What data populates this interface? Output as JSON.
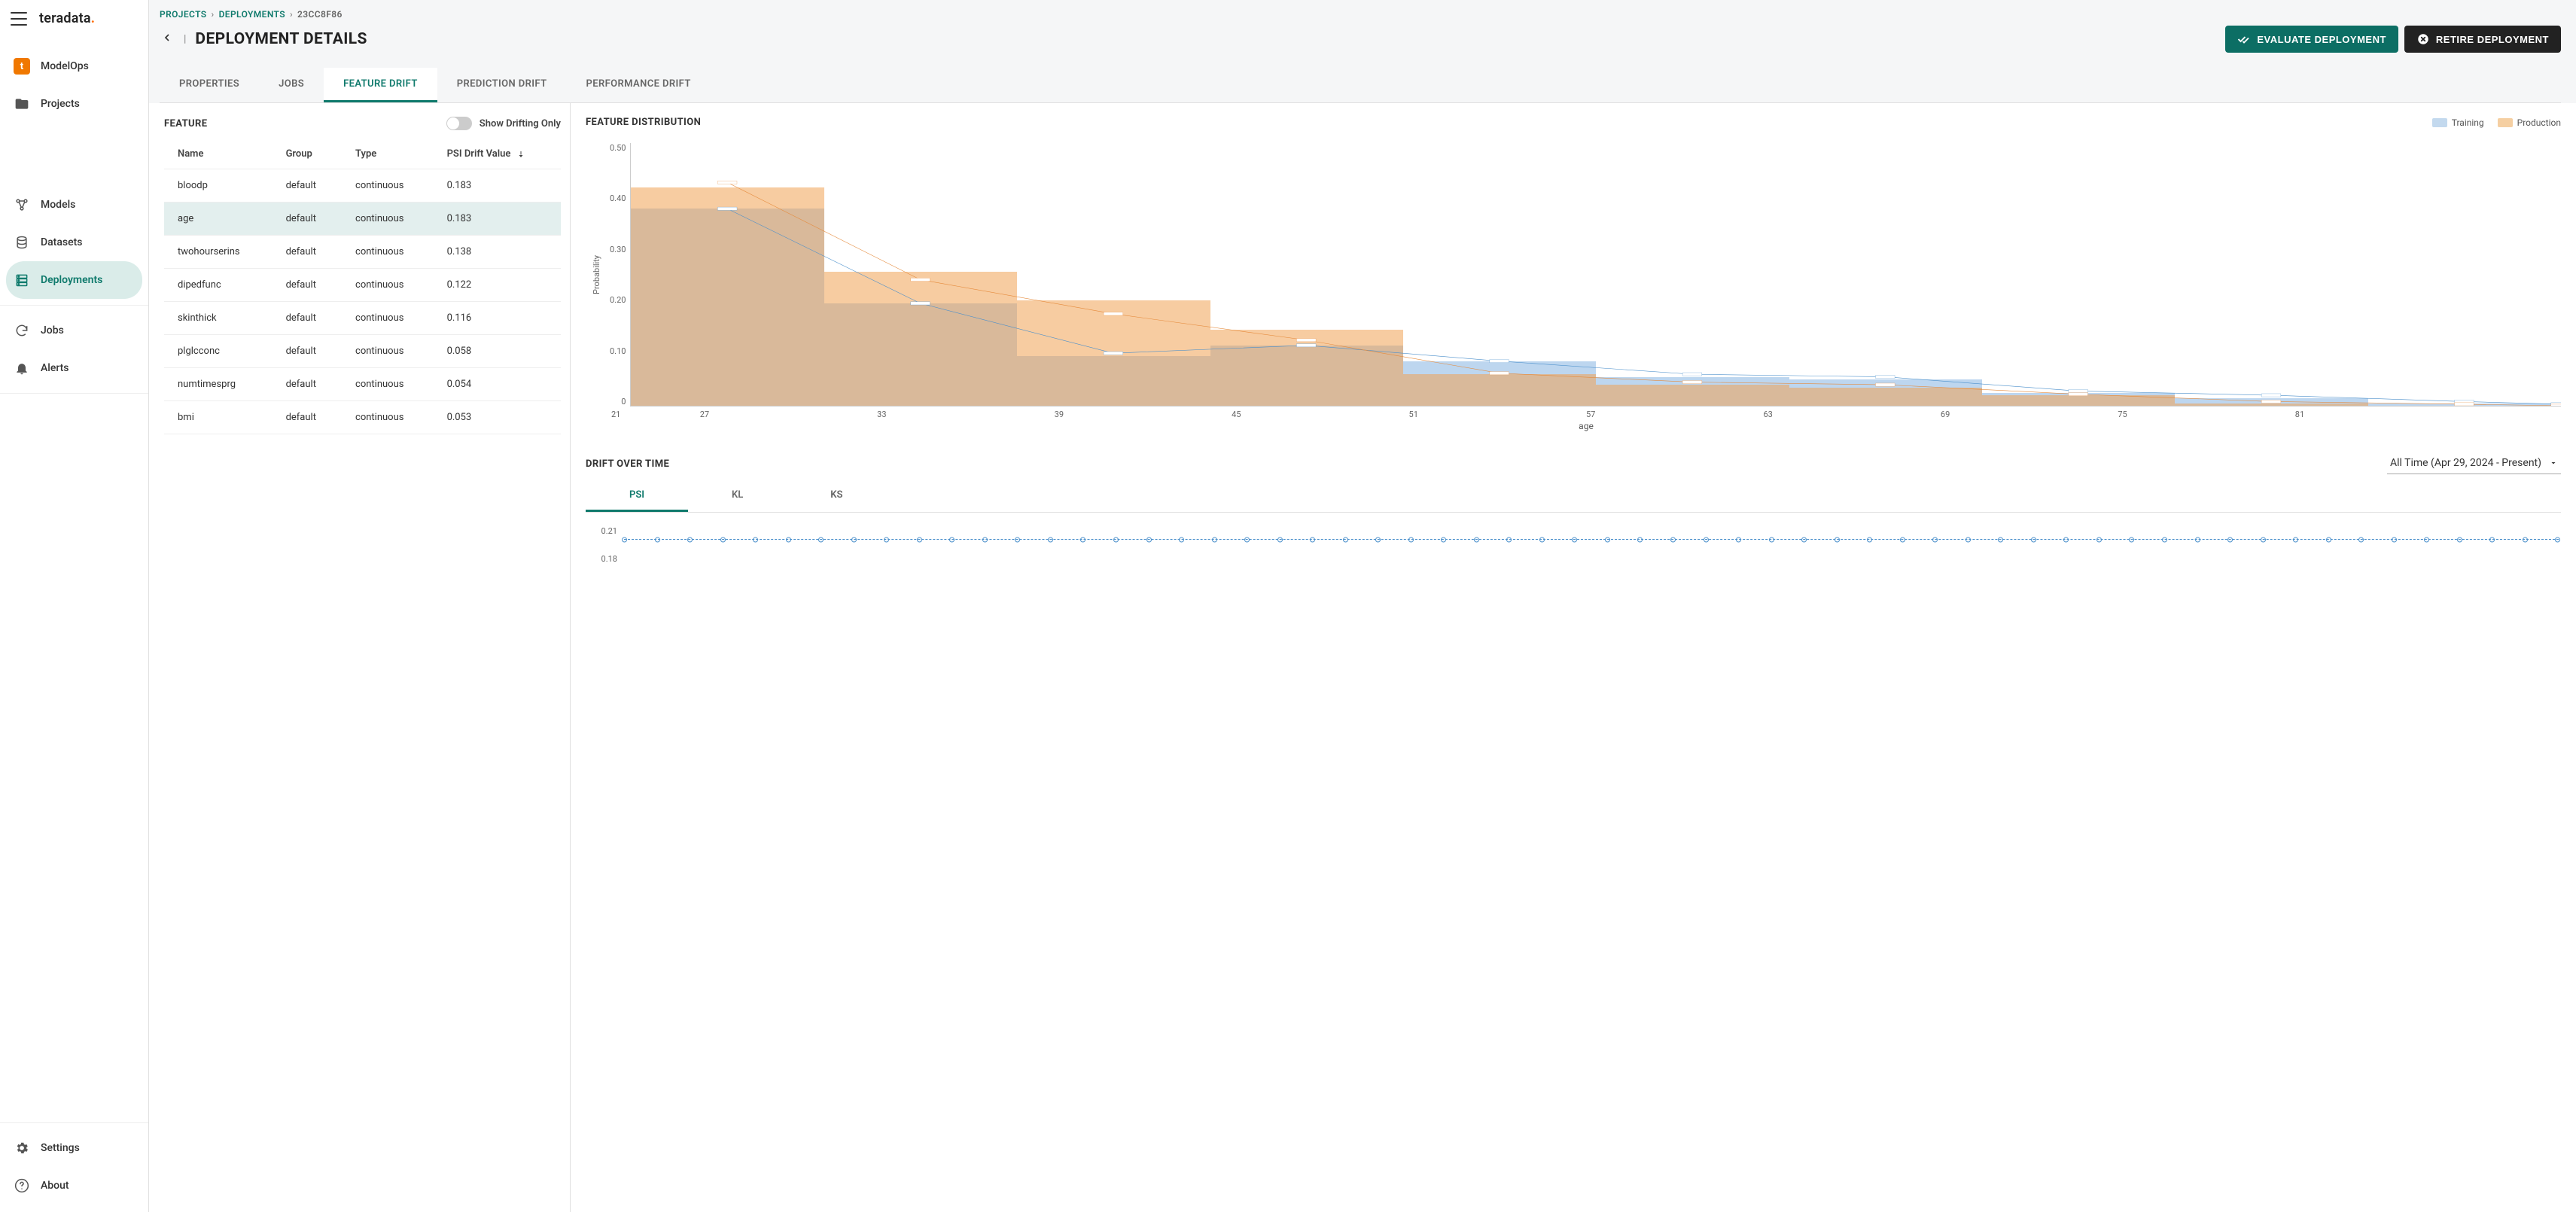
{
  "brand": {
    "name": "teradata",
    "modelops_initial": "t",
    "modelops_label": "ModelOps"
  },
  "sidebar": {
    "items": [
      {
        "label": "Projects",
        "icon": "folder-icon"
      },
      {
        "label": "Models",
        "icon": "workflow-icon"
      },
      {
        "label": "Datasets",
        "icon": "database-icon"
      },
      {
        "label": "Deployments",
        "icon": "server-icon",
        "active": true
      },
      {
        "label": "Jobs",
        "icon": "refresh-icon"
      },
      {
        "label": "Alerts",
        "icon": "bell-icon"
      }
    ],
    "footer": [
      {
        "label": "Settings",
        "icon": "gear-icon"
      },
      {
        "label": "About",
        "icon": "question-icon"
      }
    ]
  },
  "breadcrumb": {
    "parts": [
      "PROJECTS",
      "DEPLOYMENTS",
      "23CC8F86"
    ],
    "title": "DEPLOYMENT DETAILS"
  },
  "actions": {
    "evaluate": "EVALUATE DEPLOYMENT",
    "retire": "RETIRE DEPLOYMENT"
  },
  "tabs": [
    "PROPERTIES",
    "JOBS",
    "FEATURE DRIFT",
    "PREDICTION DRIFT",
    "PERFORMANCE DRIFT"
  ],
  "tabs_active": 2,
  "feature_panel": {
    "title": "FEATURE",
    "toggle_label": "Show Drifting Only",
    "columns": [
      "Name",
      "Group",
      "Type",
      "PSI Drift Value"
    ],
    "rows": [
      {
        "name": "bloodp",
        "group": "default",
        "type": "continuous",
        "psi": "0.183"
      },
      {
        "name": "age",
        "group": "default",
        "type": "continuous",
        "psi": "0.183",
        "selected": true
      },
      {
        "name": "twohourserins",
        "group": "default",
        "type": "continuous",
        "psi": "0.138"
      },
      {
        "name": "dipedfunc",
        "group": "default",
        "type": "continuous",
        "psi": "0.122"
      },
      {
        "name": "skinthick",
        "group": "default",
        "type": "continuous",
        "psi": "0.116"
      },
      {
        "name": "plglcconc",
        "group": "default",
        "type": "continuous",
        "psi": "0.058"
      },
      {
        "name": "numtimesprg",
        "group": "default",
        "type": "continuous",
        "psi": "0.054"
      },
      {
        "name": "bmi",
        "group": "default",
        "type": "continuous",
        "psi": "0.053"
      }
    ]
  },
  "distribution_panel": {
    "title": "FEATURE DISTRIBUTION",
    "legend": {
      "training": "Training",
      "production": "Production"
    },
    "ylabel": "Probability",
    "xlabel": "age"
  },
  "chart_data": {
    "type": "bar",
    "categories": [
      "21",
      "27",
      "33",
      "39",
      "45",
      "51",
      "57",
      "63",
      "69",
      "75",
      "81"
    ],
    "ylim": [
      0,
      0.5
    ],
    "yticks": [
      "0.50",
      "0.40",
      "0.30",
      "0.20",
      "0.10",
      "0"
    ],
    "xlabel": "age",
    "ylabel": "Probability",
    "series": [
      {
        "name": "Training",
        "color": "#c3d9ee",
        "values": [
          0.375,
          0.195,
          0.095,
          0.115,
          0.085,
          0.055,
          0.05,
          0.025,
          0.015,
          0.005
        ]
      },
      {
        "name": "Production",
        "color": "#f5cfa2",
        "values": [
          0.415,
          0.255,
          0.2,
          0.145,
          0.06,
          0.04,
          0.035,
          0.02,
          0.005,
          0.0
        ]
      }
    ],
    "line_series": [
      {
        "name": "Training line",
        "color": "#4a8fcb",
        "values": [
          0.375,
          0.195,
          0.1,
          0.115,
          0.085,
          0.06,
          0.055,
          0.028,
          0.02,
          0.008,
          0.003
        ]
      },
      {
        "name": "Production line",
        "color": "#e58a3b",
        "values": [
          0.425,
          0.24,
          0.175,
          0.125,
          0.062,
          0.045,
          0.04,
          0.022,
          0.008,
          0.003,
          0.0
        ]
      }
    ]
  },
  "drift_over_time": {
    "title": "DRIFT OVER TIME",
    "range_label": "All Time (Apr 29, 2024 - Present)",
    "tabs": [
      "PSI",
      "KL",
      "KS"
    ],
    "tabs_active": 0,
    "yticks": [
      "0.21",
      "0.18"
    ],
    "series_value": 0.183,
    "n_points": 60
  }
}
